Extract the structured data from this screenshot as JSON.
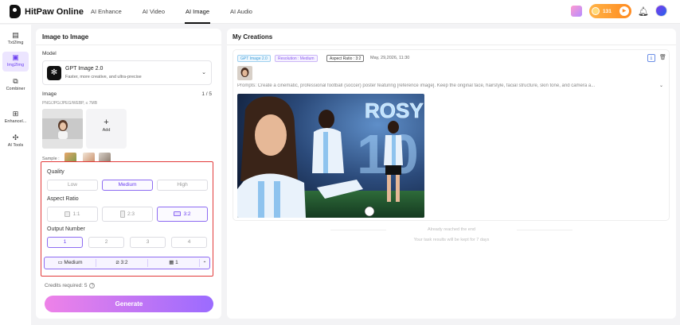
{
  "app": {
    "name": "HitPaw Online"
  },
  "nav": {
    "items": [
      "AI Enhance",
      "AI Video",
      "AI Image",
      "AI Audio"
    ],
    "active": "AI Image"
  },
  "topbar": {
    "credits": "131",
    "accent": "#ff8a1f"
  },
  "rail": {
    "items": [
      {
        "label": "Txt2Img",
        "icon": "text-to-image-icon"
      },
      {
        "label": "Img2Img",
        "icon": "image-to-image-icon",
        "active": true
      },
      {
        "label": "Combiner",
        "icon": "combiner-icon"
      },
      {
        "label": "Enhancel...",
        "icon": "enhance-icon"
      },
      {
        "label": "AI Tools",
        "icon": "tools-icon"
      }
    ]
  },
  "left": {
    "title": "Image to Image",
    "model_label": "Model",
    "model": {
      "name": "GPT Image 2.0",
      "desc": "Faster, more creative, and ultra-precise"
    },
    "image_label": "Image",
    "image_count": "1 / 5",
    "formats": "PNG/JPG/JPEG/WEBP, ≤ 7MB",
    "add_label": "Add",
    "sample_label": "Sample :",
    "quality_label": "Quality",
    "quality_options": [
      "Low",
      "Medium",
      "High"
    ],
    "quality_selected": "Medium",
    "ratio_label": "Aspect Ratio",
    "ratio_options": [
      "1:1",
      "2:3",
      "3:2"
    ],
    "ratio_selected": "3:2",
    "output_label": "Output Number",
    "output_options": [
      "1",
      "2",
      "3",
      "4"
    ],
    "output_selected": "1",
    "summary": {
      "quality": "Medium",
      "ratio": "3:2",
      "count": "1"
    },
    "credits_required": "Credits required: 5",
    "generate_label": "Generate"
  },
  "right": {
    "title": "My Creations",
    "card": {
      "tag_model": "GPT Image 2.0",
      "tag_resolution": "Resolution : Medium",
      "tag_ratio": "Aspect Ratio : 3:2",
      "date": "May, 29,2026, 11:30",
      "prompt": "Prompts: Create a cinematic, professional football (soccer) poster featuring [reference image]. Keep the original face, hairstyle, facial structure, skin tone, and camera a...",
      "poster_text": "ROSY",
      "poster_number": "10"
    },
    "end_text": "Already reached the end",
    "keep_text": "Your task results will be kept for 7 days"
  }
}
